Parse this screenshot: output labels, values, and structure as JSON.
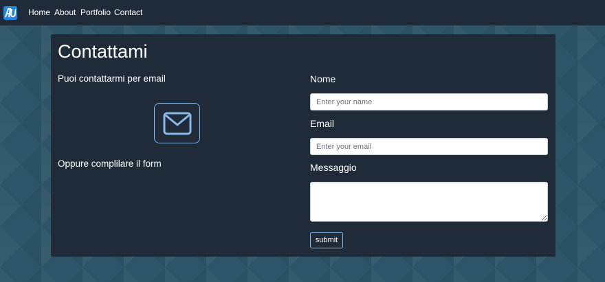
{
  "nav": {
    "logo_icon": "logo-icon",
    "links": [
      "Home",
      "About",
      "Portfolio",
      "Contact"
    ]
  },
  "contact": {
    "title": "Contattami",
    "email_text": "Puoi contattarmi per email",
    "mail_icon": "envelope-icon",
    "form_text": "Oppure complilare il form"
  },
  "form": {
    "name_label": "Nome",
    "name_placeholder": "Enter your name",
    "email_label": "Email",
    "email_placeholder": "Enter your email",
    "message_label": "Messaggio",
    "submit_label": "submit"
  },
  "colors": {
    "background": "#2e5567",
    "navbar": "#1f2b38",
    "panel": "#1f2b38",
    "accent": "#8ab8e8"
  }
}
